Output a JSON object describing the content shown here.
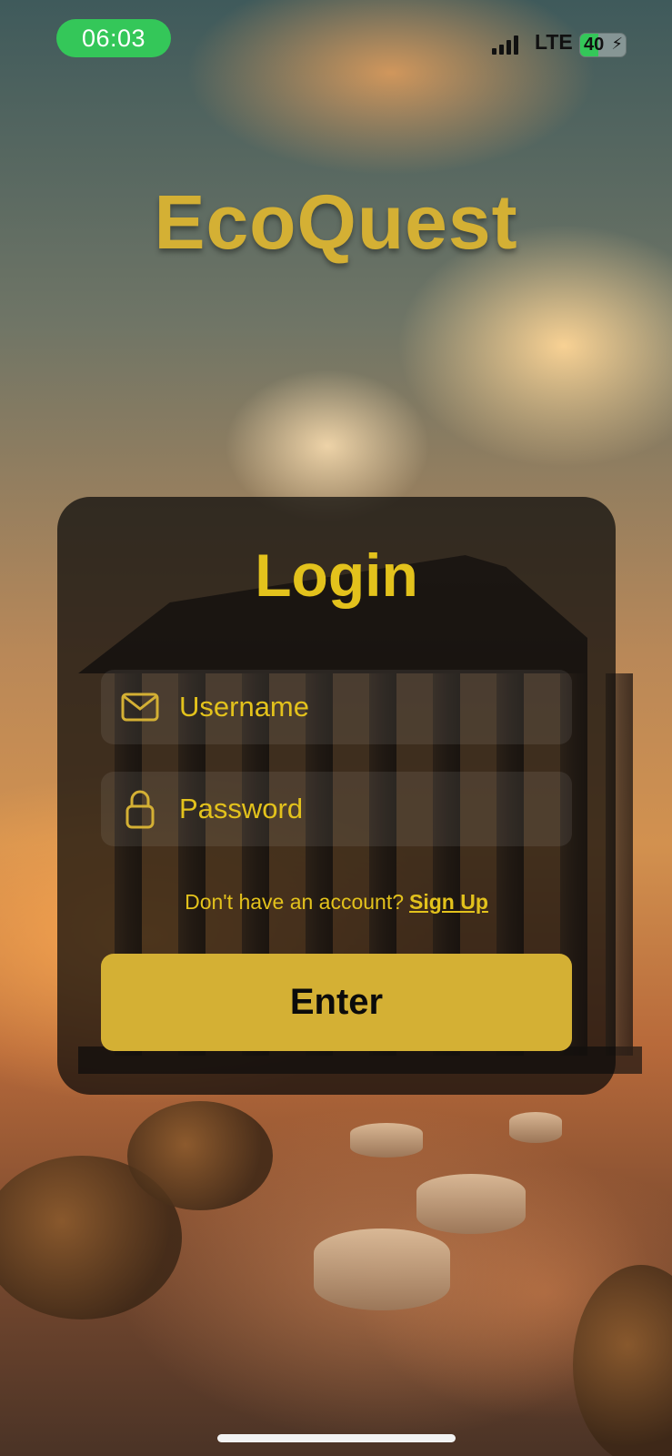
{
  "status_bar": {
    "time": "06:03",
    "network": "LTE",
    "battery": "40",
    "battery_level": 0.4
  },
  "app": {
    "title": "EcoQuest"
  },
  "login": {
    "title": "Login",
    "username_placeholder": "Username",
    "password_placeholder": "Password",
    "no_account_text": "Don't have an account?",
    "signup_link": "Sign Up",
    "enter_button": "Enter"
  },
  "colors": {
    "accent": "#d4b034",
    "text_yellow": "#e3c21c",
    "status_green": "#34c759"
  },
  "icons": {
    "username": "envelope-icon",
    "password": "lock-icon"
  }
}
